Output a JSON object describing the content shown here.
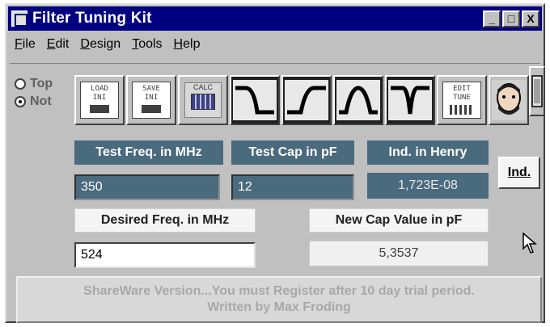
{
  "window": {
    "title": "Filter Tuning Kit",
    "buttons": {
      "minimize": "_",
      "maximize": "□",
      "close": "X"
    }
  },
  "menu": {
    "items": [
      {
        "label": "File",
        "u": "F",
        "rest": "ile"
      },
      {
        "label": "Edit",
        "u": "E",
        "rest": "dit"
      },
      {
        "label": "Design",
        "u": "D",
        "rest": "esign"
      },
      {
        "label": "Tools",
        "u": "T",
        "rest": "ools"
      },
      {
        "label": "Help",
        "u": "H",
        "rest": "elp"
      }
    ]
  },
  "toolbar": {
    "radios": [
      {
        "label": "Top",
        "checked": false
      },
      {
        "label": "Not",
        "checked": true
      }
    ],
    "buttons": [
      {
        "name": "load-ini-button",
        "text": "LOAD\nINI",
        "icon": "floppy-disk-icon"
      },
      {
        "name": "save-ini-button",
        "text": "SAVE\nINI",
        "icon": "floppy-disk-icon"
      },
      {
        "name": "calc-button",
        "text": "CALC",
        "icon": "calculator-icon"
      },
      {
        "name": "high-pass-button",
        "icon": "high-pass-curve-icon"
      },
      {
        "name": "low-pass-button",
        "icon": "low-pass-curve-icon"
      },
      {
        "name": "band-pass-button",
        "icon": "band-pass-curve-icon"
      },
      {
        "name": "band-stop-button",
        "icon": "notch-curve-icon"
      },
      {
        "name": "edit-tune-button",
        "text": "EDIT\nTUNE",
        "icon": "edit-tune-icon"
      },
      {
        "name": "about-button",
        "icon": "author-portrait-icon"
      },
      {
        "name": "exit-button",
        "icon": "exit-door-icon"
      }
    ]
  },
  "labels": {
    "test_freq": "Test Freq. in MHz",
    "test_cap": "Test Cap in pF",
    "ind_henry": "Ind. in Henry",
    "desired_freq": "Desired Freq. in MHz",
    "new_cap": "New Cap Value in pF"
  },
  "fields": {
    "test_freq": "350",
    "test_cap": "12",
    "ind_henry": "1,723E-08",
    "desired_freq": "524",
    "new_cap": "5,3537"
  },
  "ind_button": "Ind.",
  "status": {
    "line1": "ShareWare Version...You must Register after 10 day trial period.",
    "line2": "Written by Max Froding"
  }
}
